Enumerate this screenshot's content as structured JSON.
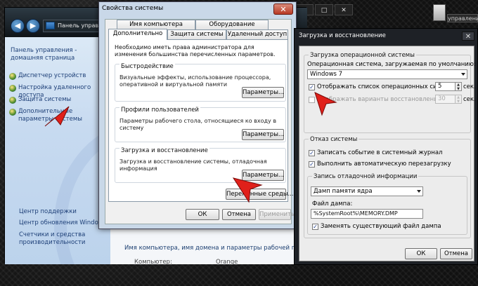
{
  "control_panel": {
    "address": "Панель управле...",
    "home_link": "Панель управления - домашняя страница",
    "links": [
      "Диспетчер устройств",
      "Настройка удаленного доступа",
      "Защита системы",
      "Дополнительные параметры системы"
    ],
    "see_also": [
      "Центр поддержки",
      "Центр обновления Windows",
      "Счетчики и средства производительности"
    ],
    "group_title": "Имя компьютера, имя домена и параметры рабочей группы",
    "row_label": "Компьютер:",
    "row_value": "Orange"
  },
  "system_properties": {
    "title": "Свойства системы",
    "tabs_row1": [
      "Имя компьютера",
      "Оборудование"
    ],
    "tabs_row2": [
      "Дополнительно",
      "Защита системы",
      "Удаленный доступ"
    ],
    "intro": "Необходимо иметь права администратора для изменения большинства перечисленных параметров.",
    "groups": [
      {
        "title": "Быстродействие",
        "desc": "Визуальные эффекты, использование процессора, оперативной и виртуальной памяти",
        "button": "Параметры..."
      },
      {
        "title": "Профили пользователей",
        "desc": "Параметры рабочего стола, относящиеся ко входу в систему",
        "button": "Параметры..."
      },
      {
        "title": "Загрузка и восстановление",
        "desc": "Загрузка и восстановление системы, отладочная информация",
        "button": "Параметры..."
      }
    ],
    "env_button": "Переменные среды...",
    "ok": "ОК",
    "cancel": "Отмена",
    "apply": "Применить"
  },
  "boot_recovery": {
    "title": "Загрузка и восстановление",
    "os_section": "Загрузка операционной системы",
    "default_os_label": "Операционная система, загружаемая по умолчанию:",
    "default_os": "Windows 7",
    "show_list_label": "Отображать список операционных систем:",
    "show_list_value": "5",
    "show_list_checked": true,
    "show_recovery_label": "Отображать варианты восстановления:",
    "show_recovery_value": "30",
    "show_recovery_checked": false,
    "sec_unit": "сек.",
    "failure_section": "Отказ системы",
    "write_event": "Записать событие в системный журнал",
    "auto_restart": "Выполнить автоматическую перезагрузку",
    "debug_section": "Запись отладочной информации",
    "dump_type": "Дамп памяти ядра",
    "dump_file_label": "Файл дампа:",
    "dump_file": "%SystemRoot%\\MEMORY.DMP",
    "overwrite": "Заменять существующий файл дампа",
    "ok": "ОК",
    "cancel": "Отмена"
  },
  "desktop": {
    "minimize": "_",
    "maximize": "□",
    "close": "✕",
    "tag": "управлени"
  },
  "colors": {
    "pointer": "#e0201a",
    "link": "#1d3f77"
  }
}
